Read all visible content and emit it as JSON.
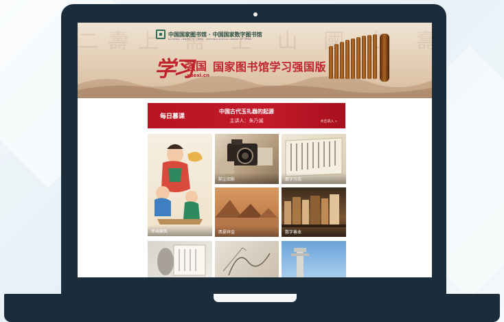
{
  "banner": {
    "library_name": "中国国家图书馆 · 中国国家数字图书馆",
    "library_name_en": "NATIONAL LIBRARY OF CHINA · NATIONAL DIGITAL LIBRARY OF CHINA",
    "logo_script": "学习",
    "logo_bold": "强国",
    "logo_url": "xuexi.cn",
    "title": "国家图书馆学习强国版"
  },
  "lecture": {
    "label": "每日慕课",
    "title": "中国古代玉礼器的起源",
    "speaker": "主讲人：朱乃诚",
    "enter": "点击进入 »"
  },
  "tiles": [
    {
      "caption": "年画撷英"
    },
    {
      "caption": "前尘旧影"
    },
    {
      "caption": "数字方志"
    },
    {
      "caption": "西夏碎金"
    },
    {
      "caption": "数字善本"
    }
  ],
  "colors": {
    "frame": "#1b2c3a",
    "accent_red": "#c0232c",
    "banner_bg": "#e3cdb4"
  }
}
